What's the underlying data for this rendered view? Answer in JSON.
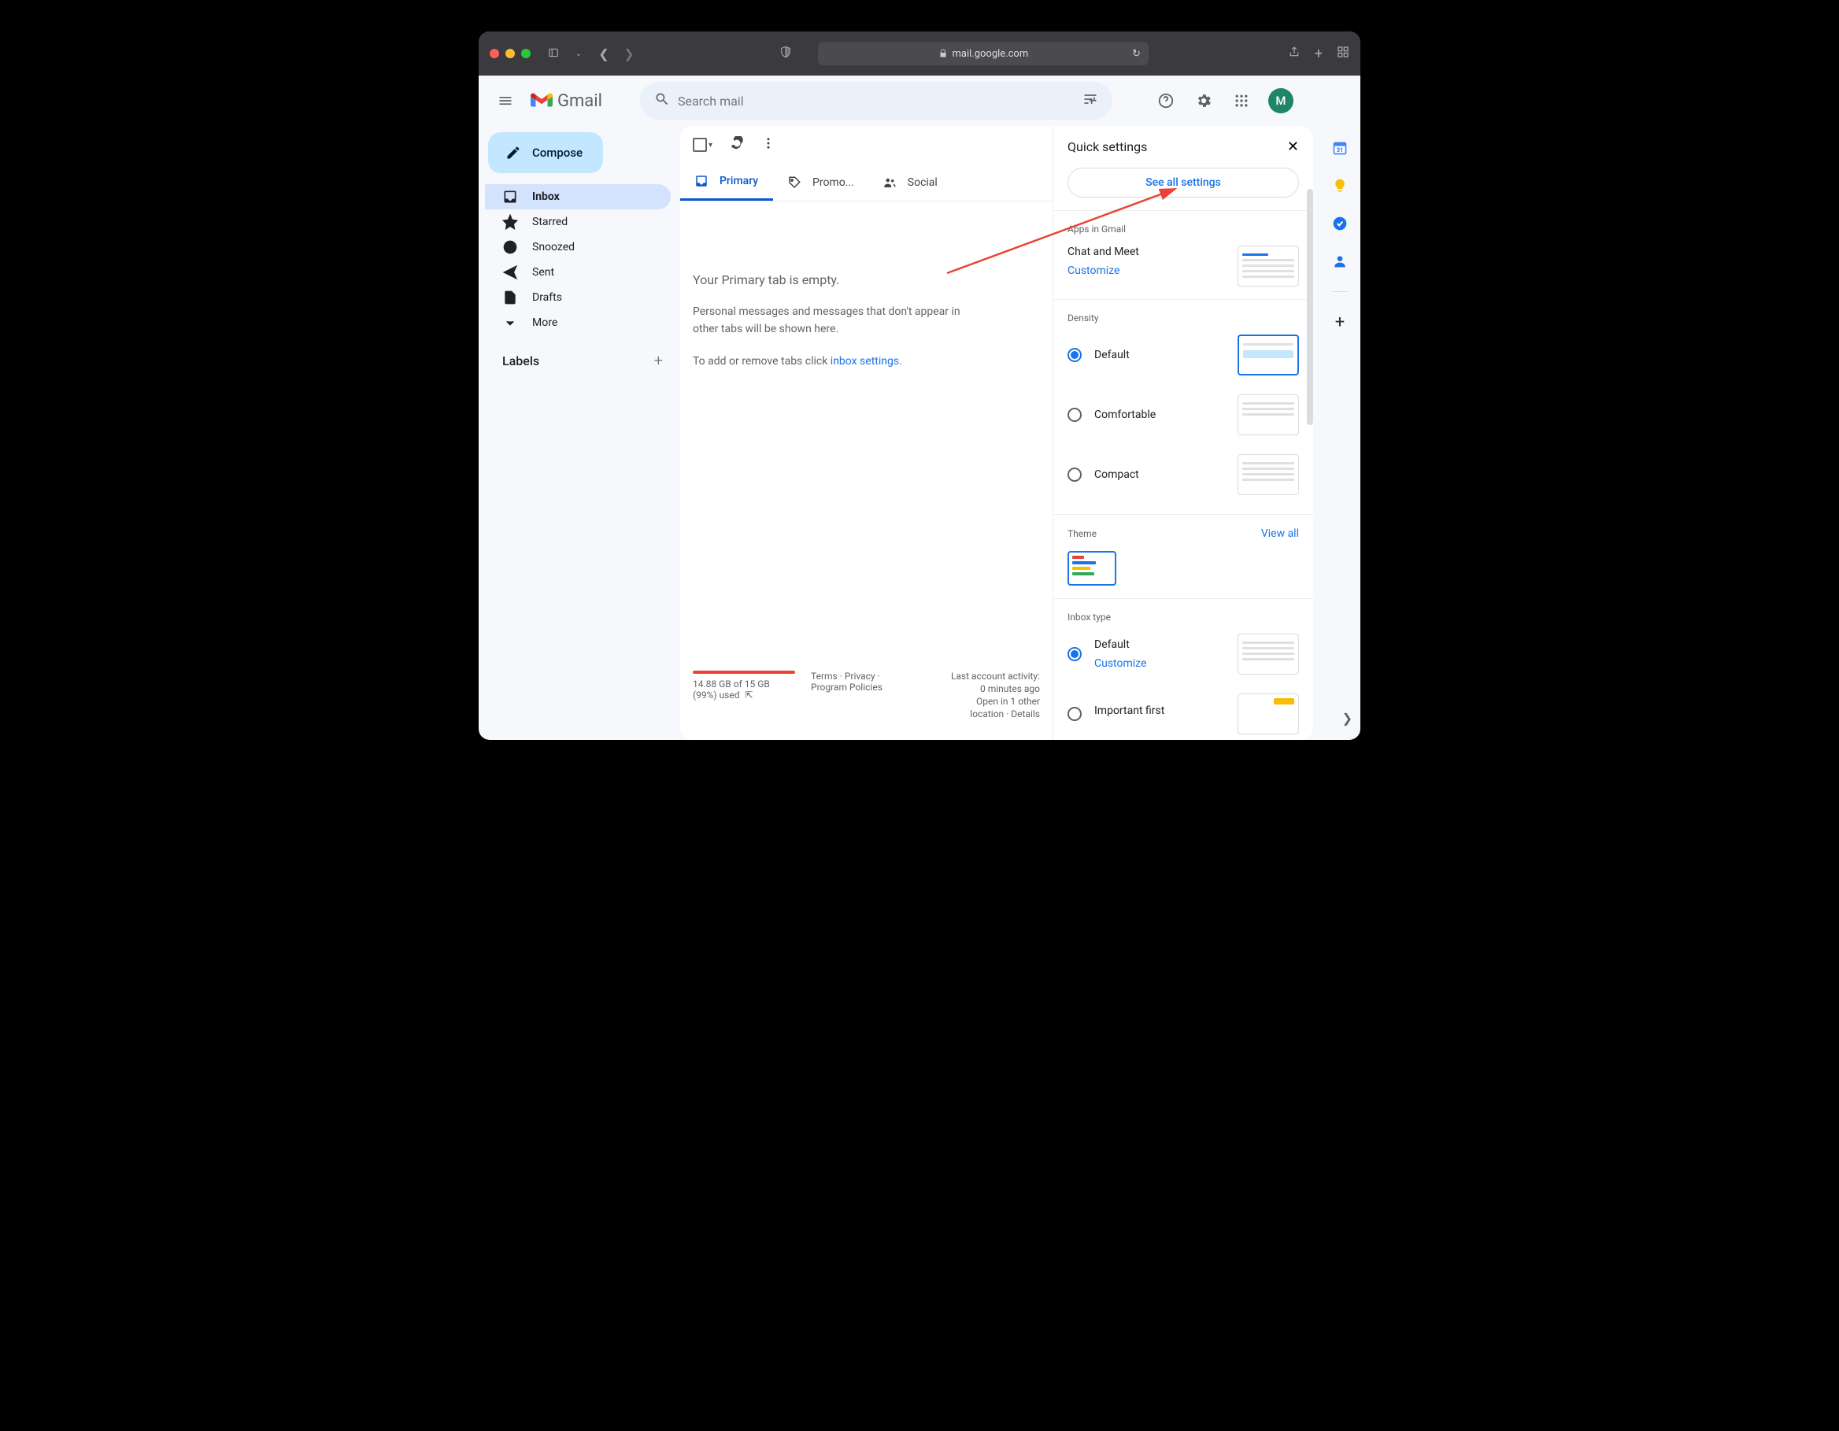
{
  "browser": {
    "url": "mail.google.com"
  },
  "header": {
    "brand": "Gmail",
    "search_placeholder": "Search mail",
    "avatar_initial": "M"
  },
  "nav": {
    "compose": "Compose",
    "items": [
      {
        "label": "Inbox"
      },
      {
        "label": "Starred"
      },
      {
        "label": "Snoozed"
      },
      {
        "label": "Sent"
      },
      {
        "label": "Drafts"
      },
      {
        "label": "More"
      }
    ],
    "labels_header": "Labels"
  },
  "tabs": {
    "primary": "Primary",
    "promotions": "Promo...",
    "social": "Social"
  },
  "empty_state": {
    "title": "Your Primary tab is empty.",
    "body": "Personal messages and messages that don't appear in other tabs will be shown here.",
    "prefix": "To add or remove tabs click ",
    "link": "inbox settings",
    "suffix": "."
  },
  "footer": {
    "storage": "14.88 GB of 15 GB (99%) used",
    "policies_line1": "Terms · Privacy ·",
    "policies_line2": "Program Policies",
    "activity_line1": "Last account activity:",
    "activity_line2": "0 minutes ago",
    "activity_line3": "Open in 1 other",
    "activity_line4": "location · Details"
  },
  "qs": {
    "title": "Quick settings",
    "see_all": "See all settings",
    "apps_section": "Apps in Gmail",
    "apps_title": "Chat and Meet",
    "customize": "Customize",
    "density_section": "Density",
    "density_default": "Default",
    "density_comfortable": "Comfortable",
    "density_compact": "Compact",
    "theme_section": "Theme",
    "view_all": "View all",
    "inbox_type_section": "Inbox type",
    "inbox_type_default": "Default",
    "inbox_type_customize": "Customize",
    "inbox_type_important": "Important first"
  },
  "sidepanel": {
    "calendar_day": "31"
  }
}
